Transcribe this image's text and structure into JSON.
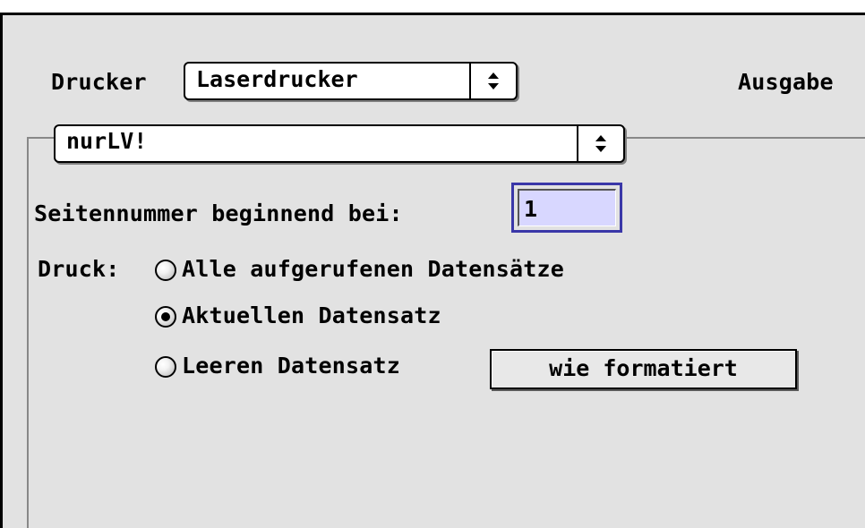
{
  "printer": {
    "label": "Drucker",
    "selected": "Laserdrucker",
    "arrows_icon": "up-down-arrows-icon"
  },
  "output": {
    "label": "Ausgabe"
  },
  "layout": {
    "selected": "nurLV!",
    "arrows_icon": "up-down-arrows-icon"
  },
  "page_number": {
    "label": "Seitennummer beginnend bei:",
    "value": "1"
  },
  "print": {
    "label": "Druck:",
    "options": [
      {
        "label": "Alle aufgerufenen Datensätze",
        "selected": false
      },
      {
        "label": "Aktuellen Datensatz",
        "selected": true
      },
      {
        "label": "Leeren Datensatz",
        "selected": false
      }
    ],
    "format_button": "wie formatiert"
  },
  "colors": {
    "window_bg": "#e2e2e2",
    "field_bg": "#d8d7ff",
    "focus_ring": "#3a37a8"
  }
}
